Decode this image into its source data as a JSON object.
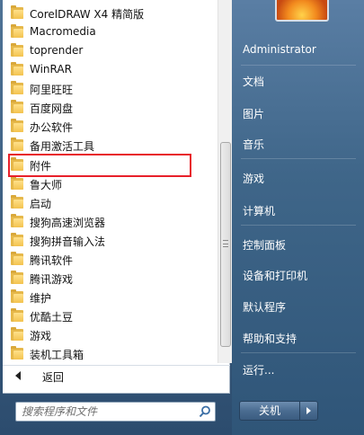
{
  "programs": [
    {
      "label": "CorelDRAW X4 精简版",
      "icon": "folder-icon"
    },
    {
      "label": "Macromedia",
      "icon": "folder-icon"
    },
    {
      "label": "toprender",
      "icon": "folder-icon"
    },
    {
      "label": "WinRAR",
      "icon": "folder-icon"
    },
    {
      "label": "阿里旺旺",
      "icon": "folder-icon"
    },
    {
      "label": "百度网盘",
      "icon": "folder-icon"
    },
    {
      "label": "办公软件",
      "icon": "folder-icon"
    },
    {
      "label": "备用激活工具",
      "icon": "folder-icon"
    },
    {
      "label": "附件",
      "icon": "folder-icon"
    },
    {
      "label": "鲁大师",
      "icon": "folder-icon"
    },
    {
      "label": "启动",
      "icon": "folder-icon"
    },
    {
      "label": "搜狗高速浏览器",
      "icon": "folder-icon"
    },
    {
      "label": "搜狗拼音输入法",
      "icon": "folder-icon"
    },
    {
      "label": "腾讯软件",
      "icon": "folder-icon"
    },
    {
      "label": "腾讯游戏",
      "icon": "folder-icon"
    },
    {
      "label": "维护",
      "icon": "folder-icon"
    },
    {
      "label": "优酷土豆",
      "icon": "folder-icon"
    },
    {
      "label": "游戏",
      "icon": "folder-icon"
    },
    {
      "label": "装机工具箱",
      "icon": "folder-icon"
    }
  ],
  "back_label": "返回",
  "search": {
    "placeholder": "搜索程序和文件"
  },
  "right_items": [
    {
      "label": "Administrator"
    },
    {
      "label": "文档"
    },
    {
      "label": "图片"
    },
    {
      "label": "音乐"
    },
    {
      "label": "游戏"
    },
    {
      "label": "计算机"
    },
    {
      "label": "控制面板"
    },
    {
      "label": "设备和打印机"
    },
    {
      "label": "默认程序"
    },
    {
      "label": "帮助和支持"
    },
    {
      "label": "运行..."
    }
  ],
  "shutdown_label": "关机",
  "colors": {
    "highlight": "#e8202a",
    "folder": "#f3c24e"
  }
}
